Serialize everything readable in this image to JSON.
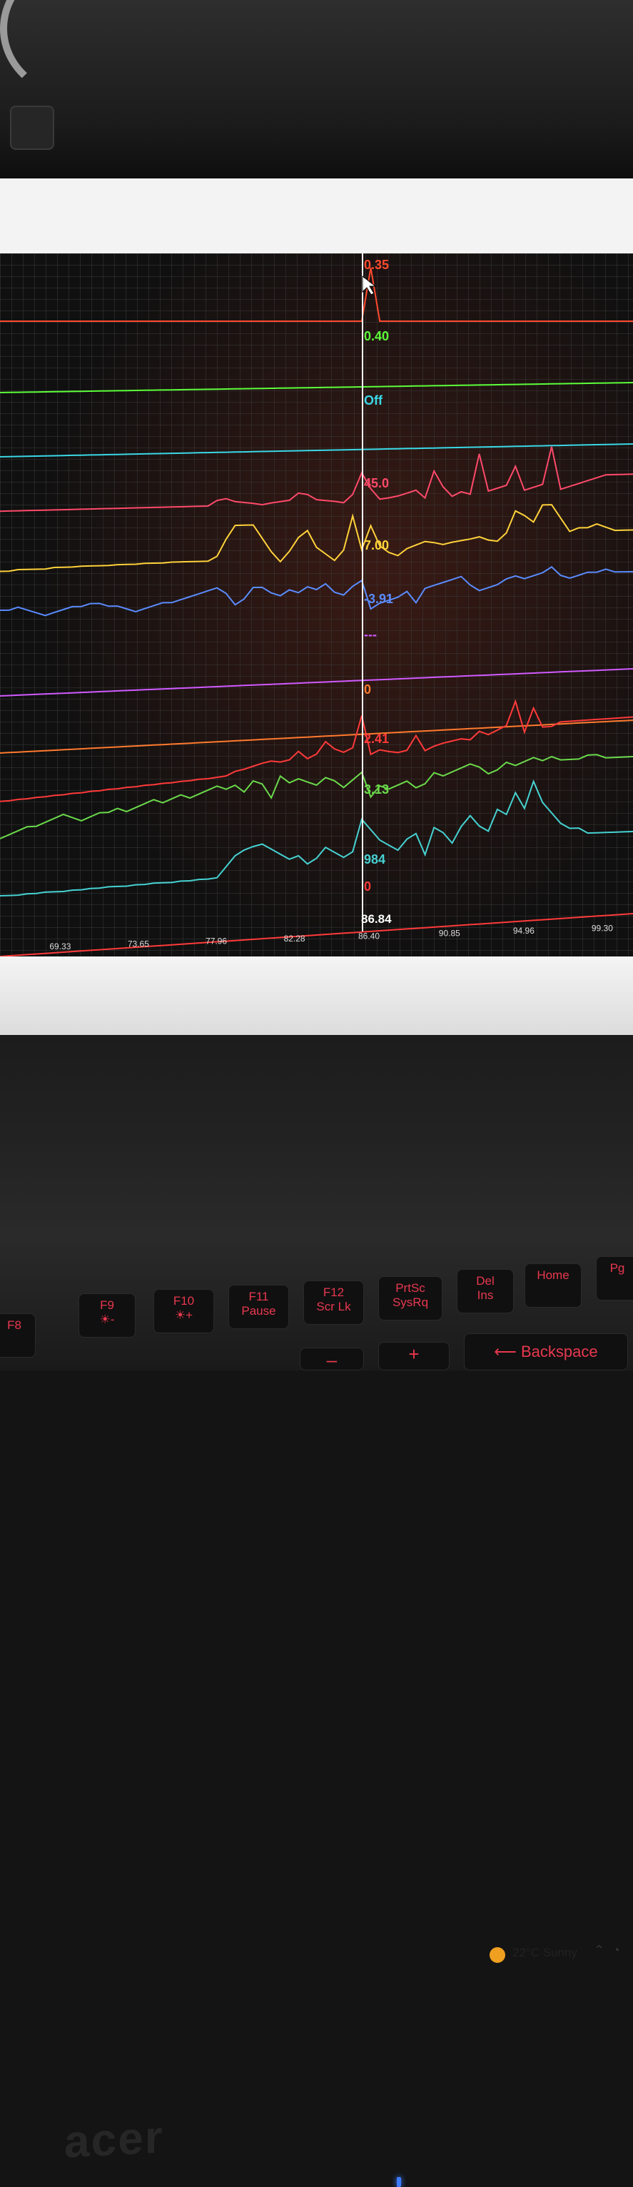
{
  "chart_data": {
    "type": "line",
    "cursor_x": 86.4,
    "xlim": [
      66.0,
      101.0
    ],
    "x_ticks": [
      "69.33",
      "73.65",
      "77.96",
      "82.28",
      "86.40",
      "90.85",
      "94.96",
      "99.30"
    ],
    "cursor_time_label": "86.84",
    "series": [
      {
        "readout": "0.35",
        "color": "#ff4a2e",
        "values": [
          0,
          0,
          0,
          0,
          0,
          0,
          0,
          0,
          0,
          0,
          0,
          0,
          0,
          0,
          0,
          0,
          0,
          0,
          0,
          0,
          0,
          0,
          0,
          0,
          0,
          0,
          0,
          0,
          0,
          0,
          0,
          0,
          0,
          0,
          0,
          0,
          0,
          0,
          0,
          0,
          0,
          1,
          0,
          0,
          0,
          0,
          0,
          0,
          0,
          0,
          0,
          0,
          0,
          0,
          0,
          0,
          0,
          0,
          0,
          0,
          0,
          0,
          0,
          0,
          0,
          0,
          0,
          0,
          0,
          0,
          0
        ]
      },
      {
        "readout": "0.40",
        "color": "#5cff3a",
        "values": [
          0,
          0,
          0,
          0,
          0,
          0,
          0,
          0,
          0,
          0,
          0,
          0,
          0,
          0,
          0,
          0,
          0,
          0,
          0,
          0,
          0,
          0,
          0,
          0,
          0,
          0,
          0,
          0,
          0,
          0,
          0,
          0,
          0,
          0,
          0,
          0,
          0,
          0,
          0,
          0,
          0,
          0,
          0,
          0,
          0,
          0,
          0,
          0,
          0,
          0,
          0,
          0,
          0,
          0,
          0,
          0,
          0,
          0,
          0,
          0,
          0,
          0,
          0,
          0,
          0,
          0,
          0,
          0,
          0,
          0,
          0
        ]
      },
      {
        "readout": "Off",
        "color": "#3ad8e6",
        "values": [
          0,
          0,
          0,
          0,
          0,
          0,
          0,
          0,
          0,
          0,
          0,
          0,
          0,
          0,
          0,
          0,
          0,
          0,
          0,
          0,
          0,
          0,
          0,
          0,
          0,
          0,
          0,
          0,
          0,
          0,
          0,
          0,
          0,
          0,
          0,
          0,
          0,
          0,
          0,
          0,
          0,
          0,
          0,
          0,
          0,
          0,
          0,
          0,
          0,
          0,
          0,
          0,
          0,
          0,
          0,
          0,
          0,
          0,
          0,
          0,
          0,
          0,
          0,
          0,
          0,
          0,
          0,
          0,
          0,
          0,
          0
        ]
      },
      {
        "readout": "45.0",
        "color": "#ff4a6a",
        "values": [
          0.05,
          0.05,
          0.05,
          0.05,
          0.05,
          0.05,
          0.05,
          0.05,
          0.05,
          0.05,
          0.05,
          0.05,
          0.05,
          0.05,
          0.05,
          0.05,
          0.05,
          0.05,
          0.05,
          0.05,
          0.05,
          0.05,
          0.05,
          0.05,
          0.15,
          0.18,
          0.12,
          0.1,
          0.08,
          0.05,
          0.08,
          0.1,
          0.12,
          0.25,
          0.22,
          0.12,
          0.1,
          0.08,
          0.05,
          0.2,
          0.6,
          0.3,
          0.1,
          0.12,
          0.15,
          0.2,
          0.25,
          0.1,
          0.6,
          0.3,
          0.12,
          0.2,
          0.15,
          0.9,
          0.2,
          0.25,
          0.3,
          0.65,
          0.2,
          0.25,
          0.3,
          1.0,
          0.2,
          0.25,
          0.3,
          0.35,
          0.4,
          0.45,
          0.45,
          0.45,
          0.45
        ]
      },
      {
        "readout": "7.00",
        "color": "#ffd23a",
        "values": [
          0.1,
          0.1,
          0.12,
          0.12,
          0.12,
          0.12,
          0.14,
          0.14,
          0.14,
          0.15,
          0.15,
          0.15,
          0.15,
          0.16,
          0.16,
          0.16,
          0.17,
          0.17,
          0.17,
          0.18,
          0.18,
          0.18,
          0.18,
          0.18,
          0.25,
          0.5,
          0.7,
          0.7,
          0.7,
          0.5,
          0.3,
          0.15,
          0.3,
          0.5,
          0.6,
          0.35,
          0.25,
          0.15,
          0.3,
          0.8,
          0.3,
          0.65,
          0.35,
          0.25,
          0.2,
          0.3,
          0.35,
          0.4,
          0.38,
          0.35,
          0.38,
          0.4,
          0.42,
          0.45,
          0.4,
          0.38,
          0.5,
          0.82,
          0.75,
          0.65,
          0.9,
          0.9,
          0.7,
          0.5,
          0.55,
          0.55,
          0.6,
          0.55,
          0.5,
          0.5,
          0.5
        ]
      },
      {
        "readout": "-3.91",
        "color": "#5a8cff",
        "values": [
          0.25,
          0.25,
          0.3,
          0.25,
          0.2,
          0.15,
          0.2,
          0.25,
          0.3,
          0.3,
          0.35,
          0.35,
          0.3,
          0.3,
          0.25,
          0.2,
          0.25,
          0.3,
          0.35,
          0.35,
          0.4,
          0.45,
          0.5,
          0.55,
          0.6,
          0.5,
          0.3,
          0.4,
          0.6,
          0.6,
          0.5,
          0.45,
          0.55,
          0.5,
          0.6,
          0.55,
          0.65,
          0.5,
          0.45,
          0.6,
          0.7,
          0.2,
          0.3,
          0.35,
          0.4,
          0.5,
          0.3,
          0.55,
          0.6,
          0.65,
          0.7,
          0.75,
          0.6,
          0.5,
          0.55,
          0.6,
          0.7,
          0.75,
          0.7,
          0.75,
          0.8,
          0.9,
          0.75,
          0.7,
          0.75,
          0.8,
          0.8,
          0.85,
          0.8,
          0.8,
          0.8
        ]
      },
      {
        "readout": "---",
        "color": "#d05aff",
        "values": [
          0,
          0,
          0,
          0,
          0,
          0,
          0,
          0,
          0,
          0,
          0,
          0,
          0,
          0,
          0,
          0,
          0,
          0,
          0,
          0,
          0,
          0,
          0,
          0,
          0,
          0,
          0,
          0,
          0,
          0,
          0,
          0,
          0,
          0,
          0,
          0,
          0,
          0,
          0,
          0,
          0,
          0,
          0,
          0,
          0,
          0,
          0,
          0,
          0,
          0,
          0,
          0,
          0,
          0,
          0,
          0,
          0,
          0,
          0,
          0,
          0,
          0,
          0,
          0,
          0,
          0,
          0,
          0,
          0,
          0,
          0
        ]
      },
      {
        "readout": "0",
        "color": "#ff7a2e",
        "values": [
          0,
          0,
          0,
          0,
          0,
          0,
          0,
          0,
          0,
          0,
          0,
          0,
          0,
          0,
          0,
          0,
          0,
          0,
          0,
          0,
          0,
          0,
          0,
          0,
          0,
          0,
          0,
          0,
          0,
          0,
          0,
          0,
          0,
          0,
          0,
          0,
          0,
          0,
          0,
          0,
          0,
          0,
          0,
          0,
          0,
          0,
          0,
          0,
          0,
          0,
          0,
          0,
          0,
          0,
          0,
          0,
          0,
          0,
          0,
          0,
          0,
          0,
          0,
          0,
          0,
          0,
          0,
          0,
          0,
          0,
          0
        ]
      },
      {
        "readout": "2.41",
        "color": "#ff3a3a",
        "values": [
          0.02,
          0.02,
          0.03,
          0.03,
          0.04,
          0.04,
          0.05,
          0.05,
          0.06,
          0.06,
          0.07,
          0.07,
          0.08,
          0.08,
          0.09,
          0.09,
          0.1,
          0.1,
          0.11,
          0.11,
          0.12,
          0.12,
          0.13,
          0.13,
          0.14,
          0.15,
          0.2,
          0.22,
          0.25,
          0.28,
          0.3,
          0.28,
          0.3,
          0.4,
          0.3,
          0.35,
          0.5,
          0.4,
          0.35,
          0.4,
          0.8,
          0.3,
          0.35,
          0.32,
          0.3,
          0.32,
          0.5,
          0.3,
          0.35,
          0.38,
          0.4,
          0.42,
          0.4,
          0.5,
          0.45,
          0.5,
          0.55,
          0.85,
          0.45,
          0.75,
          0.5,
          0.5,
          0.55,
          0.55,
          0.55,
          0.55,
          0.55,
          0.55,
          0.55,
          0.55,
          0.55
        ]
      },
      {
        "readout": "3.13",
        "color": "#6ad94a",
        "values": [
          0.1,
          0.15,
          0.2,
          0.25,
          0.25,
          0.3,
          0.35,
          0.4,
          0.35,
          0.3,
          0.35,
          0.4,
          0.4,
          0.45,
          0.4,
          0.45,
          0.5,
          0.55,
          0.5,
          0.55,
          0.6,
          0.55,
          0.6,
          0.65,
          0.7,
          0.65,
          0.7,
          0.6,
          0.75,
          0.7,
          0.5,
          0.8,
          0.7,
          0.75,
          0.7,
          0.65,
          0.75,
          0.7,
          0.6,
          0.7,
          0.8,
          0.45,
          0.6,
          0.55,
          0.6,
          0.65,
          0.55,
          0.6,
          0.75,
          0.7,
          0.75,
          0.8,
          0.85,
          0.8,
          0.7,
          0.75,
          0.85,
          0.8,
          0.85,
          0.9,
          0.85,
          0.9,
          0.85,
          0.85,
          0.85,
          0.9,
          0.9,
          0.85,
          0.85,
          0.85,
          0.85
        ]
      },
      {
        "readout": "984",
        "color": "#46d2d2",
        "values": [
          0.1,
          0.1,
          0.1,
          0.11,
          0.11,
          0.12,
          0.12,
          0.12,
          0.13,
          0.13,
          0.14,
          0.14,
          0.15,
          0.15,
          0.15,
          0.16,
          0.16,
          0.17,
          0.17,
          0.17,
          0.18,
          0.18,
          0.19,
          0.19,
          0.2,
          0.3,
          0.4,
          0.45,
          0.48,
          0.5,
          0.45,
          0.4,
          0.35,
          0.38,
          0.3,
          0.35,
          0.45,
          0.4,
          0.35,
          0.4,
          0.7,
          0.6,
          0.5,
          0.45,
          0.4,
          0.5,
          0.55,
          0.35,
          0.6,
          0.55,
          0.45,
          0.6,
          0.7,
          0.6,
          0.55,
          0.75,
          0.7,
          0.9,
          0.75,
          1.0,
          0.8,
          0.7,
          0.6,
          0.55,
          0.55,
          0.5,
          0.5,
          0.5,
          0.5,
          0.5,
          0.5
        ]
      },
      {
        "readout": "0",
        "color": "#ff3a3a",
        "values": [
          0,
          0,
          0,
          0,
          0,
          0,
          0,
          0,
          0,
          0,
          0,
          0,
          0,
          0,
          0,
          0,
          0,
          0,
          0,
          0,
          0,
          0,
          0,
          0,
          0,
          0,
          0,
          0,
          0,
          0,
          0,
          0,
          0,
          0,
          0,
          0,
          0,
          0,
          0,
          0,
          0,
          0,
          0,
          0,
          0,
          0,
          0,
          0,
          0,
          0,
          0,
          0,
          0,
          0,
          0,
          0,
          0,
          0,
          0,
          0,
          0,
          0,
          0,
          0,
          0,
          0,
          0,
          0,
          0,
          0,
          0
        ]
      }
    ]
  },
  "taskbar": {
    "weather_temp": "22°C",
    "weather_condition": "Sunny",
    "chevron_icon": "chevron-up-icon",
    "wifi_icon": "wifi-icon"
  },
  "laptop": {
    "brand": "acer"
  },
  "keyboard": {
    "keys": [
      {
        "top": "F8",
        "bottom": ""
      },
      {
        "top": "F9",
        "bottom": "☀-"
      },
      {
        "top": "F10",
        "bottom": "☀+"
      },
      {
        "top": "F11",
        "bottom": "Pause"
      },
      {
        "top": "F12",
        "bottom": "Scr Lk"
      },
      {
        "top": "PrtSc",
        "bottom": "SysRq"
      },
      {
        "top": "Del",
        "bottom": "Ins"
      },
      {
        "top": "Home",
        "bottom": ""
      },
      {
        "top": "Pg",
        "bottom": ""
      }
    ],
    "backspace_label": "⟵ Backspace",
    "plus_label": "+",
    "minus_label": "–"
  }
}
